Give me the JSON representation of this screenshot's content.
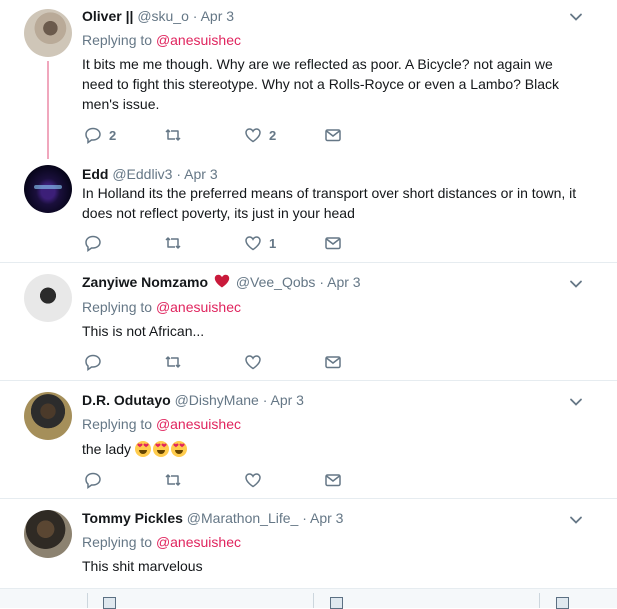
{
  "tweets": [
    {
      "name": "Oliver ||",
      "handle": "@sku_o",
      "dot": "·",
      "date": "Apr 3",
      "replying_prefix": "Replying to",
      "replying_to": "@anesuishec",
      "text": "It bits me me though. Why are we reflected as poor. A Bicycle? not again we need to fight this stereotype. Why not a Rolls-Royce or even a Lambo? Black men's issue.",
      "replies": "2",
      "retweets": "",
      "likes": "2"
    },
    {
      "name": "Edd",
      "handle": "@Eddliv3",
      "dot": "·",
      "date": "Apr 3",
      "text": "In Holland its the preferred means of transport over short distances or in town, it does not reflect poverty, its just in your head",
      "replies": "",
      "retweets": "",
      "likes": "1"
    },
    {
      "name": "Zanyiwe Nomzamo",
      "handle": "@Vee_Qobs",
      "dot": "·",
      "date": "Apr 3",
      "replying_prefix": "Replying to",
      "replying_to": "@anesuishec",
      "text": "This is not African...",
      "replies": "",
      "retweets": "",
      "likes": ""
    },
    {
      "name": "D.R. Odutayo",
      "handle": "@DishyMane",
      "dot": "·",
      "date": "Apr 3",
      "replying_prefix": "Replying to",
      "replying_to": "@anesuishec",
      "text": "the lady",
      "replies": "",
      "retweets": "",
      "likes": ""
    },
    {
      "name": "Tommy Pickles",
      "handle": "@Marathon_Life_",
      "dot": "·",
      "date": "Apr 3",
      "replying_prefix": "Replying to",
      "replying_to": "@anesuishec",
      "text": "This shit marvelous"
    }
  ],
  "colors": {
    "mention": "#e0245e",
    "muted": "#657786",
    "thread_line": "#f0a7bd",
    "heart_emoji": "#c91a3b"
  },
  "icons": [
    "reply-icon",
    "retweet-icon",
    "like-icon",
    "dm-icon",
    "chevron-down-icon",
    "heart-emoji-icon",
    "heart-eyes-emoji"
  ]
}
